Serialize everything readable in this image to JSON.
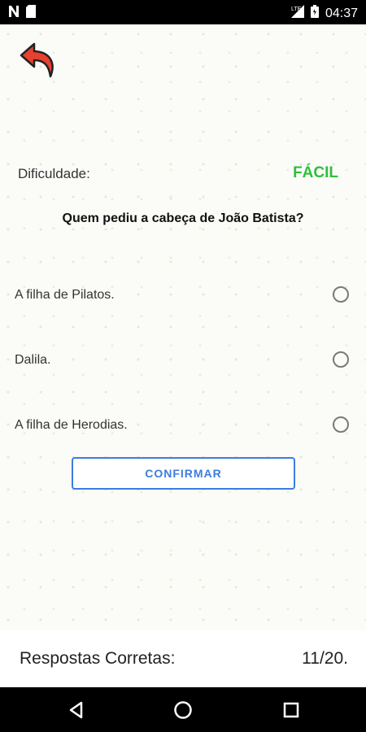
{
  "status_bar": {
    "time": "04:37",
    "icons": [
      "n-notification-icon",
      "sd-card-icon",
      "lte-signal-icon",
      "battery-icon"
    ]
  },
  "toolbar": {
    "back_icon": "back-arrow-icon"
  },
  "difficulty": {
    "label": "Dificuldade:",
    "value": "FÁCIL",
    "color": "#2fbf3b"
  },
  "question": "Quem pediu a cabeça de João Batista?",
  "options": [
    {
      "label": "A filha de Pilatos.",
      "selected": false
    },
    {
      "label": "Dalila.",
      "selected": false
    },
    {
      "label": "A filha de Herodias.",
      "selected": false
    }
  ],
  "confirm_label": "CONFIRMAR",
  "score": {
    "label": "Respostas Corretas:",
    "value": "11/20."
  },
  "colors": {
    "accent": "#3b7de0",
    "back_arrow": "#e8402f"
  }
}
